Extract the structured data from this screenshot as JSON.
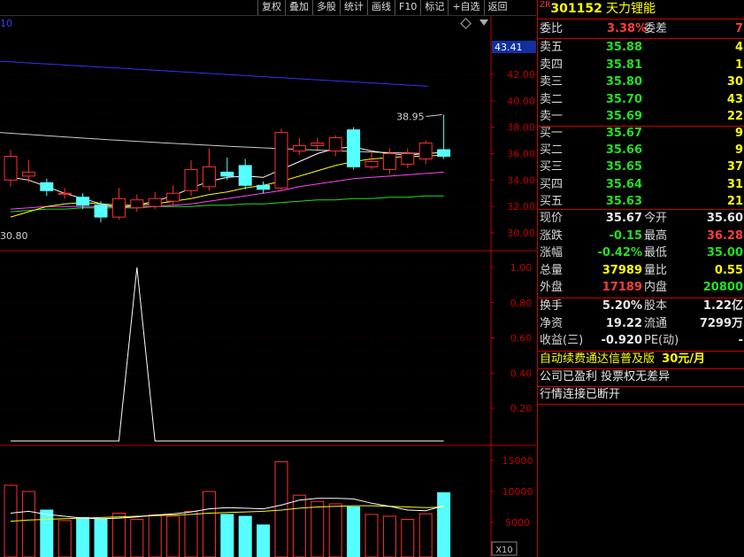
{
  "toolbar": [
    "复权",
    "叠加",
    "多股",
    "统计",
    "画线",
    "F10",
    "标记",
    "+自选",
    "返回"
  ],
  "chart": {
    "top_left_label": "10",
    "current_price_tag": "43.41",
    "price_axis": [
      "42.00",
      "40.00",
      "38.00",
      "36.00",
      "34.00",
      "32.00",
      "30.00"
    ],
    "low_label": "30.80",
    "high_annotation": "38.95",
    "indicator_axis": [
      "1.00",
      "0.80",
      "0.60",
      "0.40",
      "0.20"
    ],
    "volume_axis": [
      "15000",
      "10000",
      "5000"
    ],
    "volume_unit": "X10",
    "colors": {
      "up": "#ff3030",
      "down": "#55ffff",
      "ma1": "#ffffff",
      "ma2": "#ffff00",
      "ma3": "#ff44ff",
      "ma4": "#22dd22",
      "ma5": "#3333ff",
      "grid": "#c00000"
    },
    "candles": [
      {
        "o": 34.0,
        "c": 35.8,
        "h": 36.3,
        "l": 33.5
      },
      {
        "o": 34.3,
        "c": 34.6,
        "h": 35.5,
        "l": 33.8
      },
      {
        "o": 33.8,
        "c": 33.2,
        "h": 34.1,
        "l": 32.8
      },
      {
        "o": 33.0,
        "c": 33.0,
        "h": 33.4,
        "l": 32.6
      },
      {
        "o": 32.7,
        "c": 32.1,
        "h": 33.0,
        "l": 31.8
      },
      {
        "o": 32.1,
        "c": 31.2,
        "h": 32.4,
        "l": 30.8
      },
      {
        "o": 31.2,
        "c": 32.6,
        "h": 33.4,
        "l": 31.0
      },
      {
        "o": 31.9,
        "c": 32.5,
        "h": 32.9,
        "l": 31.6
      },
      {
        "o": 32.0,
        "c": 32.6,
        "h": 33.1,
        "l": 31.8
      },
      {
        "o": 32.4,
        "c": 33.0,
        "h": 33.6,
        "l": 32.1
      },
      {
        "o": 33.2,
        "c": 34.8,
        "h": 35.5,
        "l": 32.8
      },
      {
        "o": 33.5,
        "c": 35.0,
        "h": 36.4,
        "l": 33.2
      },
      {
        "o": 34.6,
        "c": 34.3,
        "h": 35.7,
        "l": 34.0
      },
      {
        "o": 35.1,
        "c": 33.6,
        "h": 35.6,
        "l": 33.3
      },
      {
        "o": 33.6,
        "c": 33.3,
        "h": 33.9,
        "l": 33.0
      },
      {
        "o": 33.4,
        "c": 37.6,
        "h": 37.9,
        "l": 33.2
      },
      {
        "o": 36.2,
        "c": 36.6,
        "h": 37.2,
        "l": 35.9
      },
      {
        "o": 36.6,
        "c": 36.8,
        "h": 37.2,
        "l": 36.3
      },
      {
        "o": 36.2,
        "c": 37.2,
        "h": 37.4,
        "l": 35.8
      },
      {
        "o": 37.8,
        "c": 35.0,
        "h": 38.0,
        "l": 34.8
      },
      {
        "o": 35.0,
        "c": 35.4,
        "h": 36.2,
        "l": 34.8
      },
      {
        "o": 34.8,
        "c": 36.0,
        "h": 36.4,
        "l": 34.5
      },
      {
        "o": 35.2,
        "c": 36.0,
        "h": 36.4,
        "l": 34.9
      },
      {
        "o": 35.6,
        "c": 36.8,
        "h": 37.0,
        "l": 35.2
      },
      {
        "o": 36.3,
        "c": 35.8,
        "h": 38.95,
        "l": 35.6
      }
    ],
    "ma1": [
      34.2,
      34.0,
      33.5,
      33.0,
      32.6,
      32.2,
      31.9,
      32.1,
      32.4,
      32.8,
      33.4,
      33.9,
      34.2,
      34.3,
      34.2,
      34.8,
      35.4,
      36.0,
      36.4,
      36.5,
      36.2,
      36.0,
      35.9,
      36.0,
      36.1
    ],
    "ma2": [
      31.2,
      31.6,
      32.0,
      32.2,
      32.3,
      32.2,
      32.1,
      32.1,
      32.2,
      32.4,
      32.6,
      32.9,
      33.1,
      33.4,
      33.6,
      33.9,
      34.3,
      34.7,
      35.1,
      35.4,
      35.6,
      35.7,
      35.8,
      35.8,
      35.9
    ],
    "ma3": [
      31.8,
      31.9,
      32.0,
      32.0,
      32.0,
      32.0,
      32.0,
      32.0,
      32.0,
      32.1,
      32.2,
      32.4,
      32.6,
      32.8,
      33.0,
      33.2,
      33.5,
      33.7,
      33.9,
      34.1,
      34.2,
      34.3,
      34.4,
      34.5,
      34.6
    ],
    "ma4": [
      31.6,
      31.7,
      31.8,
      31.8,
      31.9,
      31.9,
      31.9,
      31.9,
      32.0,
      32.0,
      32.0,
      32.1,
      32.1,
      32.2,
      32.2,
      32.3,
      32.4,
      32.5,
      32.5,
      32.6,
      32.6,
      32.7,
      32.7,
      32.8,
      32.8
    ],
    "ma5_range": [
      43.0,
      41.1
    ],
    "ma200_left": 37.6,
    "indicator_values": [
      0,
      0,
      0,
      0,
      0,
      0,
      0,
      1,
      0,
      0,
      0,
      0,
      0,
      0,
      0,
      0,
      0,
      0,
      0,
      0,
      0,
      0,
      0,
      0,
      0
    ],
    "volumes": [
      11000,
      10000,
      7000,
      5300,
      5800,
      5500,
      6500,
      5500,
      6200,
      6000,
      6800,
      10000,
      6300,
      6000,
      4600,
      14800,
      9400,
      8400,
      8000,
      7500,
      6300,
      6000,
      5500,
      6400,
      9800
    ],
    "vol_ma1": [
      6500,
      6800,
      6300,
      6000,
      5700,
      5600,
      5700,
      5900,
      6200,
      6400,
      6700,
      7200,
      7400,
      7300,
      7200,
      7800,
      8600,
      8900,
      8900,
      8800,
      8100,
      7600,
      7000,
      6900,
      7700
    ],
    "vol_ma2": [
      5200,
      5400,
      5500,
      5600,
      5700,
      5800,
      5900,
      6000,
      6100,
      6200,
      6300,
      6500,
      6600,
      6700,
      6800,
      7000,
      7300,
      7500,
      7600,
      7700,
      7700,
      7600,
      7500,
      7400,
      7500
    ]
  },
  "stock": {
    "prefix": "ZR",
    "code": "301152",
    "name": "天力锂能"
  },
  "weibi": {
    "label": "委比",
    "value": "3.38%",
    "label2": "委差",
    "value2": "7"
  },
  "asks": [
    {
      "label": "卖五",
      "price": "35.88",
      "vol": "4"
    },
    {
      "label": "卖四",
      "price": "35.81",
      "vol": "1"
    },
    {
      "label": "卖三",
      "price": "35.80",
      "vol": "30"
    },
    {
      "label": "卖二",
      "price": "35.70",
      "vol": "43"
    },
    {
      "label": "卖一",
      "price": "35.69",
      "vol": "22"
    }
  ],
  "bids": [
    {
      "label": "买一",
      "price": "35.67",
      "vol": "9"
    },
    {
      "label": "买二",
      "price": "35.66",
      "vol": "9"
    },
    {
      "label": "买三",
      "price": "35.65",
      "vol": "37"
    },
    {
      "label": "买四",
      "price": "35.64",
      "vol": "31"
    },
    {
      "label": "买五",
      "price": "35.63",
      "vol": "21"
    }
  ],
  "quote": [
    {
      "l1": "现价",
      "v1": "35.67",
      "l2": "今开",
      "v2": "35.60"
    },
    {
      "l1": "涨跌",
      "v1": "-0.15",
      "l2": "最高",
      "v2": "36.28"
    },
    {
      "l1": "涨幅",
      "v1": "-0.42%",
      "l2": "最低",
      "v2": "35.00"
    },
    {
      "l1": "总量",
      "v1": "37989",
      "l2": "量比",
      "v2": "0.55"
    },
    {
      "l1": "外盘",
      "v1": "17189",
      "l2": "内盘",
      "v2": "20800"
    }
  ],
  "fund": [
    {
      "l1": "换手",
      "v1": "5.20%",
      "l2": "股本",
      "v2": "1.22亿"
    },
    {
      "l1": "净资",
      "v1": "19.22",
      "l2": "流通",
      "v2": "7299万"
    },
    {
      "l1": "收益(三)",
      "v1": "-0.920",
      "l2": "PE(动)",
      "v2": "-"
    }
  ],
  "ad": {
    "text": "自动续费通达信普及版",
    "price": "30元/月"
  },
  "notices": [
    "公司已盈利 投票权无差异",
    "行情连接已断开"
  ]
}
